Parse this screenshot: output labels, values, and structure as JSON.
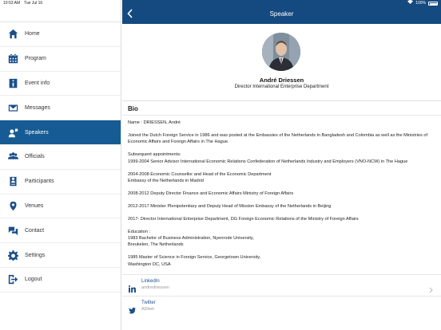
{
  "statusbar": {
    "time": "10:53 AM",
    "date": "Tue Jul 16",
    "battery": "100%"
  },
  "sidebar": {
    "items": [
      {
        "label": "Home",
        "icon": "home-icon"
      },
      {
        "label": "Program",
        "icon": "calendar-icon"
      },
      {
        "label": "Event info",
        "icon": "info-icon"
      },
      {
        "label": "Messages",
        "icon": "envelope-icon"
      },
      {
        "label": "Speakers",
        "icon": "speaker-icon",
        "active": true
      },
      {
        "label": "Officials",
        "icon": "officials-icon"
      },
      {
        "label": "Participants",
        "icon": "participants-icon"
      },
      {
        "label": "Venues",
        "icon": "map-pin-icon"
      },
      {
        "label": "Contact",
        "icon": "chat-icon"
      },
      {
        "label": "Settings",
        "icon": "gear-icon"
      },
      {
        "label": "Logout",
        "icon": "logout-icon"
      }
    ]
  },
  "header": {
    "title": "Speaker"
  },
  "speaker": {
    "name": "André Driessen",
    "role": "Director International Enterprise Department"
  },
  "bio": {
    "heading": "Bio",
    "paragraphs": [
      "Name : DRIESSEN, André",
      "Joined the Dutch Foreign Service in 1986 and was posted at the Embassies of the Netherlands in Bangladesh and Colombia as well as the Ministries of Economic Affairs and Foreign Affairs in The Hague.",
      "Subsequent appointments:\n1999-2004 Senior Advisor International Economic Relations Confederation of Netherlands Industry and Employers (VNO-NCW) in The Hague",
      "2004-2008 Economic Counsellor and Head of the Economic Department\nEmbassy of the Netherlands in Madrid",
      "2008-2012 Deputy Director Finance and Economic Affairs Ministry of Foreign Affairs",
      "2012-2017 Minister Plenipotentiary and Deputy Head of Mission Embassy of the Netherlands in Beijing",
      "2017- Director International Enterprise Department, DG Foreign Economic Relations of the Ministry of Foreign Affairs",
      "Education :\n1983 Bachelor of Business Administration, Nyenrode University,\nBreukelen, The Netherlands",
      "1985 Master of Science in Foreign Service, Georgetown University,\nWashington DC, USA"
    ]
  },
  "links": [
    {
      "label": "LinkedIn",
      "value": "andredriessen",
      "icon": "linkedin-icon"
    },
    {
      "label": "Twitter",
      "value": "ADtwit",
      "icon": "twitter-icon"
    }
  ],
  "colors": {
    "header": "#154a80",
    "active": "#165b94",
    "icon": "#1b4f8a"
  }
}
